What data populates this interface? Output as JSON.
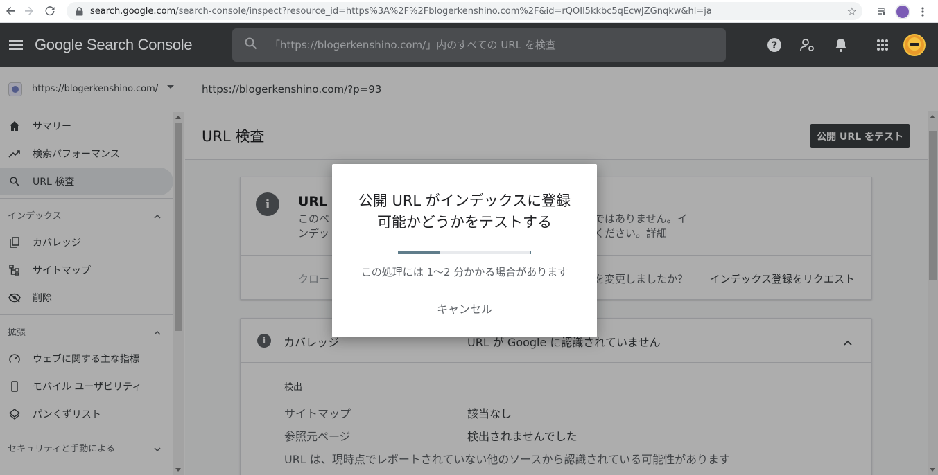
{
  "browser": {
    "url_host": "search.google.com",
    "url_rest": "/search-console/inspect?resource_id=https%3A%2F%2Fblogerkenshino.com%2F&id=rQOIl5kkbc5qEcwJZGnqkw&hl=ja"
  },
  "app": {
    "logo": "Google Search Console",
    "search_placeholder": "「https://blogerkenshino.com/」内のすべての URL を検査"
  },
  "sidebar": {
    "property": "https://blogerkenshino.com/",
    "items": [
      {
        "label": "サマリー",
        "icon": "home-icon"
      },
      {
        "label": "検索パフォーマンス",
        "icon": "trending-up-icon"
      },
      {
        "label": "URL 検査",
        "icon": "search-icon"
      }
    ],
    "index_section": "インデックス",
    "index_items": [
      {
        "label": "カバレッジ",
        "icon": "copy-icon"
      },
      {
        "label": "サイトマップ",
        "icon": "sitemap-icon"
      },
      {
        "label": "削除",
        "icon": "eye-off-icon"
      }
    ],
    "enhance_section": "拡張",
    "enhance_items": [
      {
        "label": "ウェブに関する主な指標",
        "icon": "speed-icon"
      },
      {
        "label": "モバイル ユーザビリティ",
        "icon": "phone-icon"
      },
      {
        "label": "パンくずリスト",
        "icon": "layers-icon"
      }
    ],
    "security_section": "セキュリティと手動による"
  },
  "main": {
    "inspected_url": "https://blogerkenshino.com/?p=93",
    "page_title": "URL 検査",
    "test_button": "公開 URL をテスト",
    "card1": {
      "title": "URL が",
      "desc1": "このペ",
      "desc2": "ンデッ",
      "desc_r1": "ではありません。イ",
      "desc_r2": "ください。",
      "detail_link": "詳細",
      "crawl": "クロー",
      "changed": "を変更しましたか？",
      "request": "インデックス登録をリクエスト"
    },
    "card2": {
      "title": "カバレッジ",
      "status": "URL が Google に認識されていません",
      "subhead": "検出",
      "rows": [
        {
          "k": "サイトマップ",
          "v": "該当なし"
        },
        {
          "k": "参照元ページ",
          "v": "検出されませんでした"
        }
      ],
      "note": "URL は、現時点でレポートされていない他のソースから認識されている可能性があります"
    }
  },
  "dialog": {
    "title_line1": "公開 URL がインデックスに登録",
    "title_line2": "可能かどうかをテストする",
    "progress": 0.32,
    "message": "この処理には 1〜2 分かかる場合があります",
    "cancel": "キャンセル"
  },
  "colors": {
    "appbar": "#2f3133",
    "progress": "#607d8b"
  }
}
